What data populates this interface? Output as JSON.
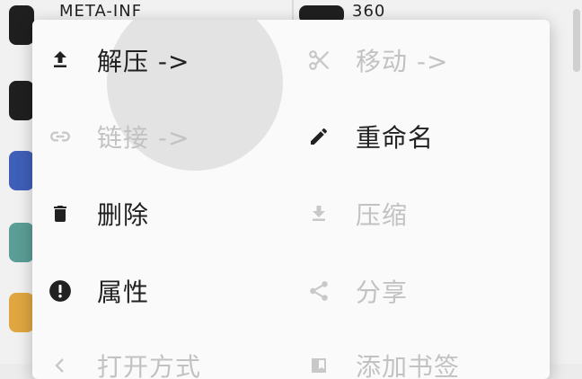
{
  "background": {
    "left_top_name": "META-INF",
    "right_top_name": "360"
  },
  "menu": {
    "items": [
      {
        "label": "解压 ->",
        "icon": "upload-icon",
        "enabled": true
      },
      {
        "label": "移动 ->",
        "icon": "scissors-icon",
        "enabled": false
      },
      {
        "label": "链接 ->",
        "icon": "link-icon",
        "enabled": false
      },
      {
        "label": "重命名",
        "icon": "pencil-icon",
        "enabled": true
      },
      {
        "label": "删除",
        "icon": "trash-icon",
        "enabled": true
      },
      {
        "label": "压缩",
        "icon": "download-icon",
        "enabled": false
      },
      {
        "label": "属性",
        "icon": "info-icon",
        "enabled": true
      },
      {
        "label": "分享",
        "icon": "share-icon",
        "enabled": false
      },
      {
        "label": "打开方式",
        "icon": "chevron-icon",
        "enabled": false
      },
      {
        "label": "添加书签",
        "icon": "bookmark-icon",
        "enabled": false
      }
    ]
  },
  "colors": {
    "enabled_text": "#212121",
    "disabled_text": "#c2c2c2",
    "menu_bg": "#fafafa"
  }
}
